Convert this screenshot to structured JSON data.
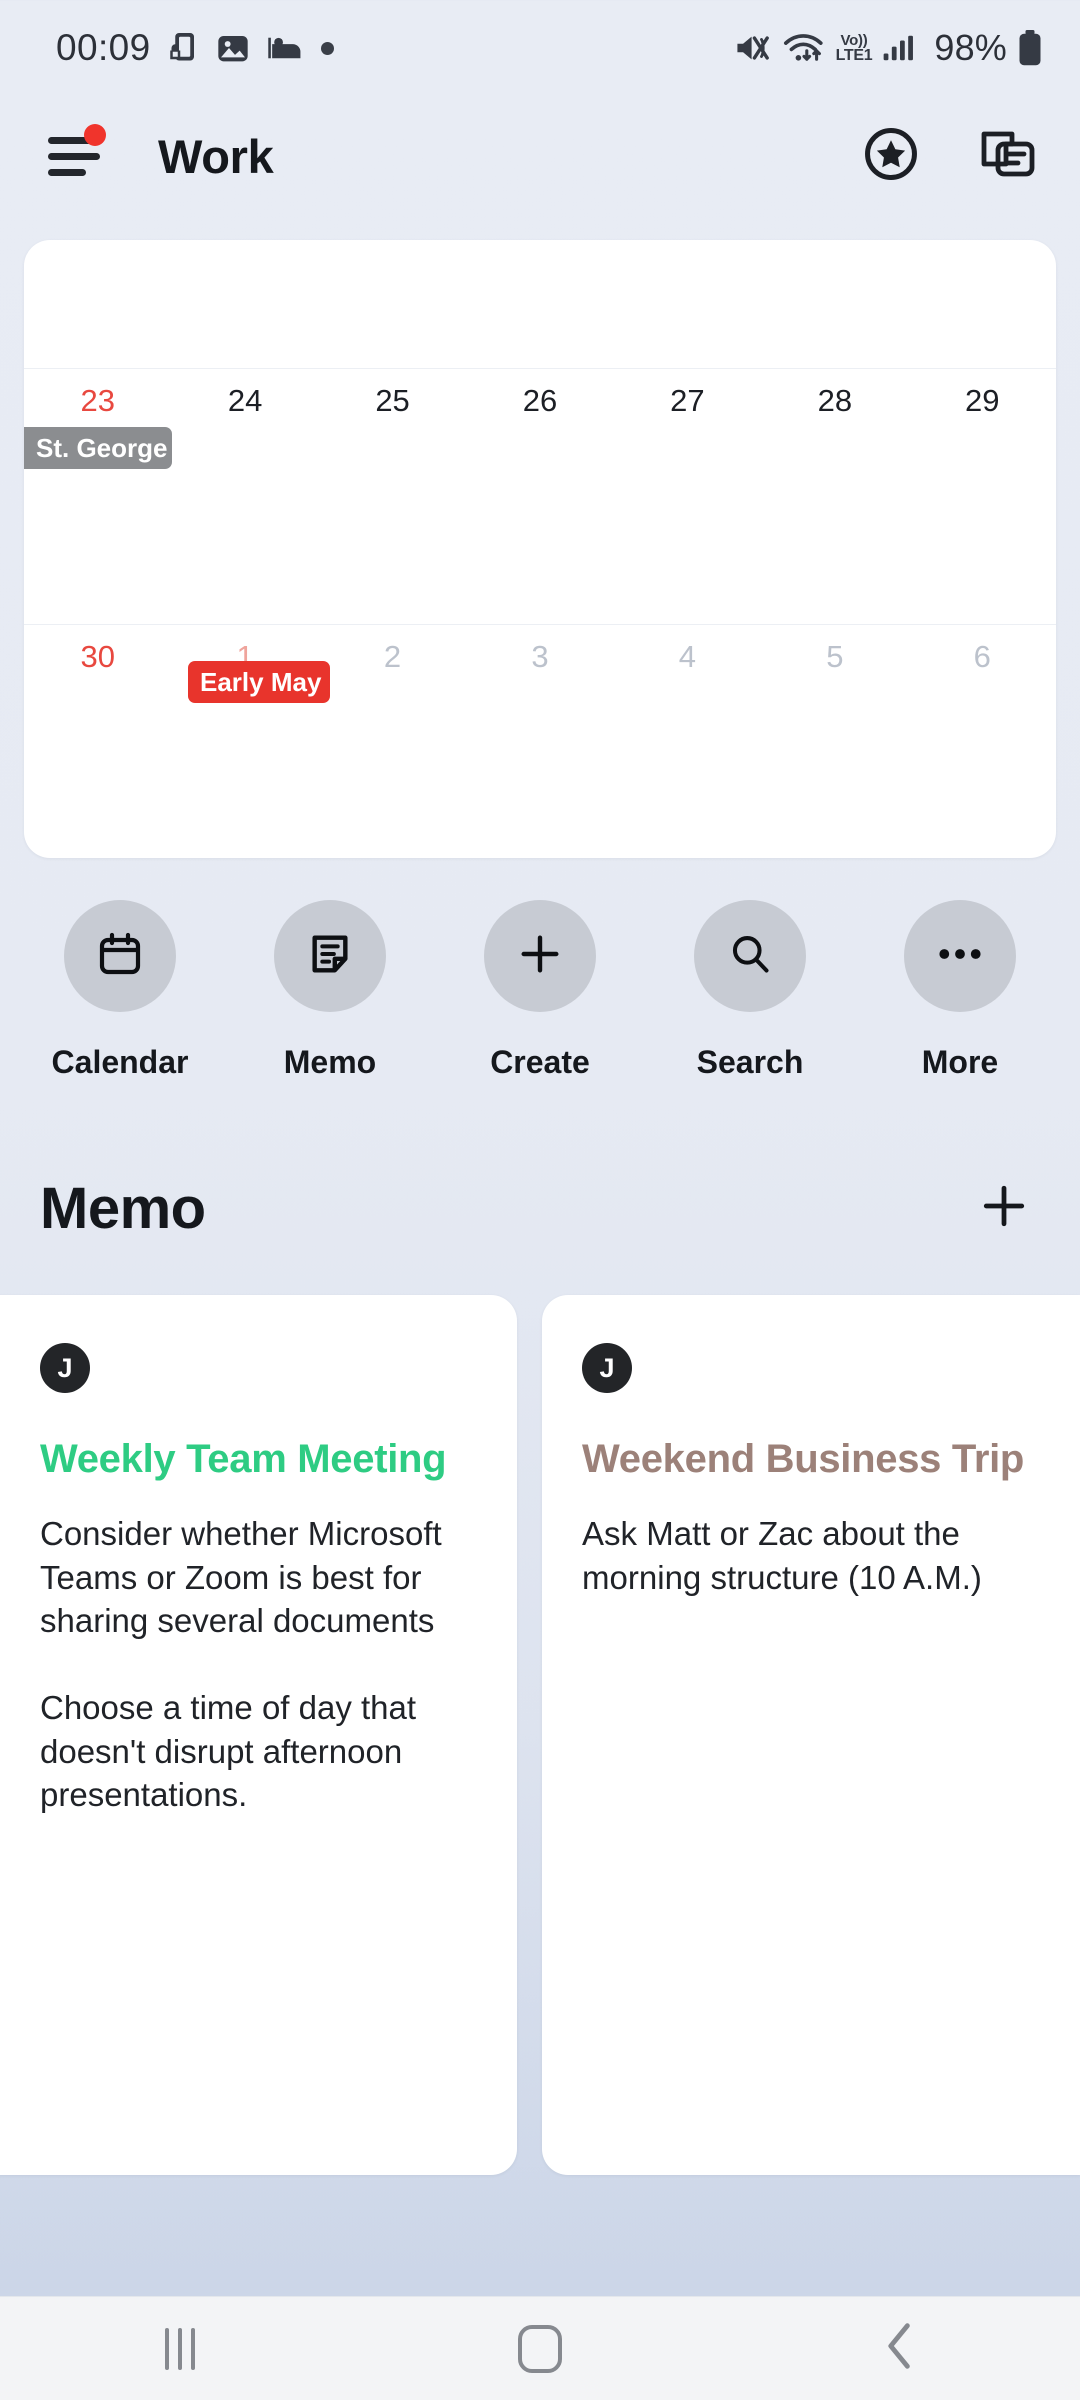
{
  "status_bar": {
    "time": "00:09",
    "left_icons": [
      "phone-lock-icon",
      "image-icon",
      "bed-icon",
      "dot-icon"
    ],
    "mute_icon": "mute-icon",
    "wifi_icon": "wifi-icon",
    "volte_top": "Vo))",
    "volte_bottom": "LTE1",
    "signal_icon": "signal-bars-icon",
    "battery_percent": "98%",
    "battery_icon": "battery-icon"
  },
  "app_bar": {
    "menu_icon": "hamburger-menu-icon",
    "has_notification_dot": true,
    "title": "Work",
    "favorites_icon": "star-circle-icon",
    "cards_icon": "stacked-cards-icon"
  },
  "calendar": {
    "weeks": [
      {
        "days": [
          {
            "label": "23",
            "style": "red"
          },
          {
            "label": "24",
            "style": "normal"
          },
          {
            "label": "25",
            "style": "normal"
          },
          {
            "label": "26",
            "style": "normal"
          },
          {
            "label": "27",
            "style": "normal"
          },
          {
            "label": "28",
            "style": "normal"
          },
          {
            "label": "29",
            "style": "normal"
          }
        ],
        "events": [
          {
            "label": "St. George",
            "color": "#8b8d90",
            "day_index": 0
          }
        ]
      },
      {
        "days": [
          {
            "label": "30",
            "style": "red-bold"
          },
          {
            "label": "1",
            "style": "muted-red"
          },
          {
            "label": "2",
            "style": "muted"
          },
          {
            "label": "3",
            "style": "muted"
          },
          {
            "label": "4",
            "style": "muted"
          },
          {
            "label": "5",
            "style": "muted"
          },
          {
            "label": "6",
            "style": "muted"
          }
        ],
        "events": [
          {
            "label": "Early May",
            "color": "#e8342c",
            "day_index": 1
          }
        ]
      }
    ]
  },
  "quick_actions": [
    {
      "label": "Calendar",
      "icon": "calendar-icon"
    },
    {
      "label": "Memo",
      "icon": "memo-icon"
    },
    {
      "label": "Create",
      "icon": "plus-icon"
    },
    {
      "label": "Search",
      "icon": "search-icon"
    },
    {
      "label": "More",
      "icon": "more-horizontal-icon"
    }
  ],
  "memo_section": {
    "title": "Memo",
    "add_icon": "plus-icon",
    "cards": [
      {
        "avatar_initial": "J",
        "title": "Weekly Team Meeting",
        "title_color": "#2ecc83",
        "body": "Consider whether Microsoft Teams or Zoom is best for sharing several documents\n\nChoose a time of day that doesn't disrupt afternoon presentations."
      },
      {
        "avatar_initial": "J",
        "title": "Weekend Business Trip",
        "title_color": "#9c8179",
        "body": "Ask Matt or Zac about the morning structure (10 A.M.)"
      }
    ]
  },
  "nav_bar": {
    "recents_icon": "recents-icon",
    "home_icon": "home-icon",
    "back_icon": "back-icon"
  }
}
